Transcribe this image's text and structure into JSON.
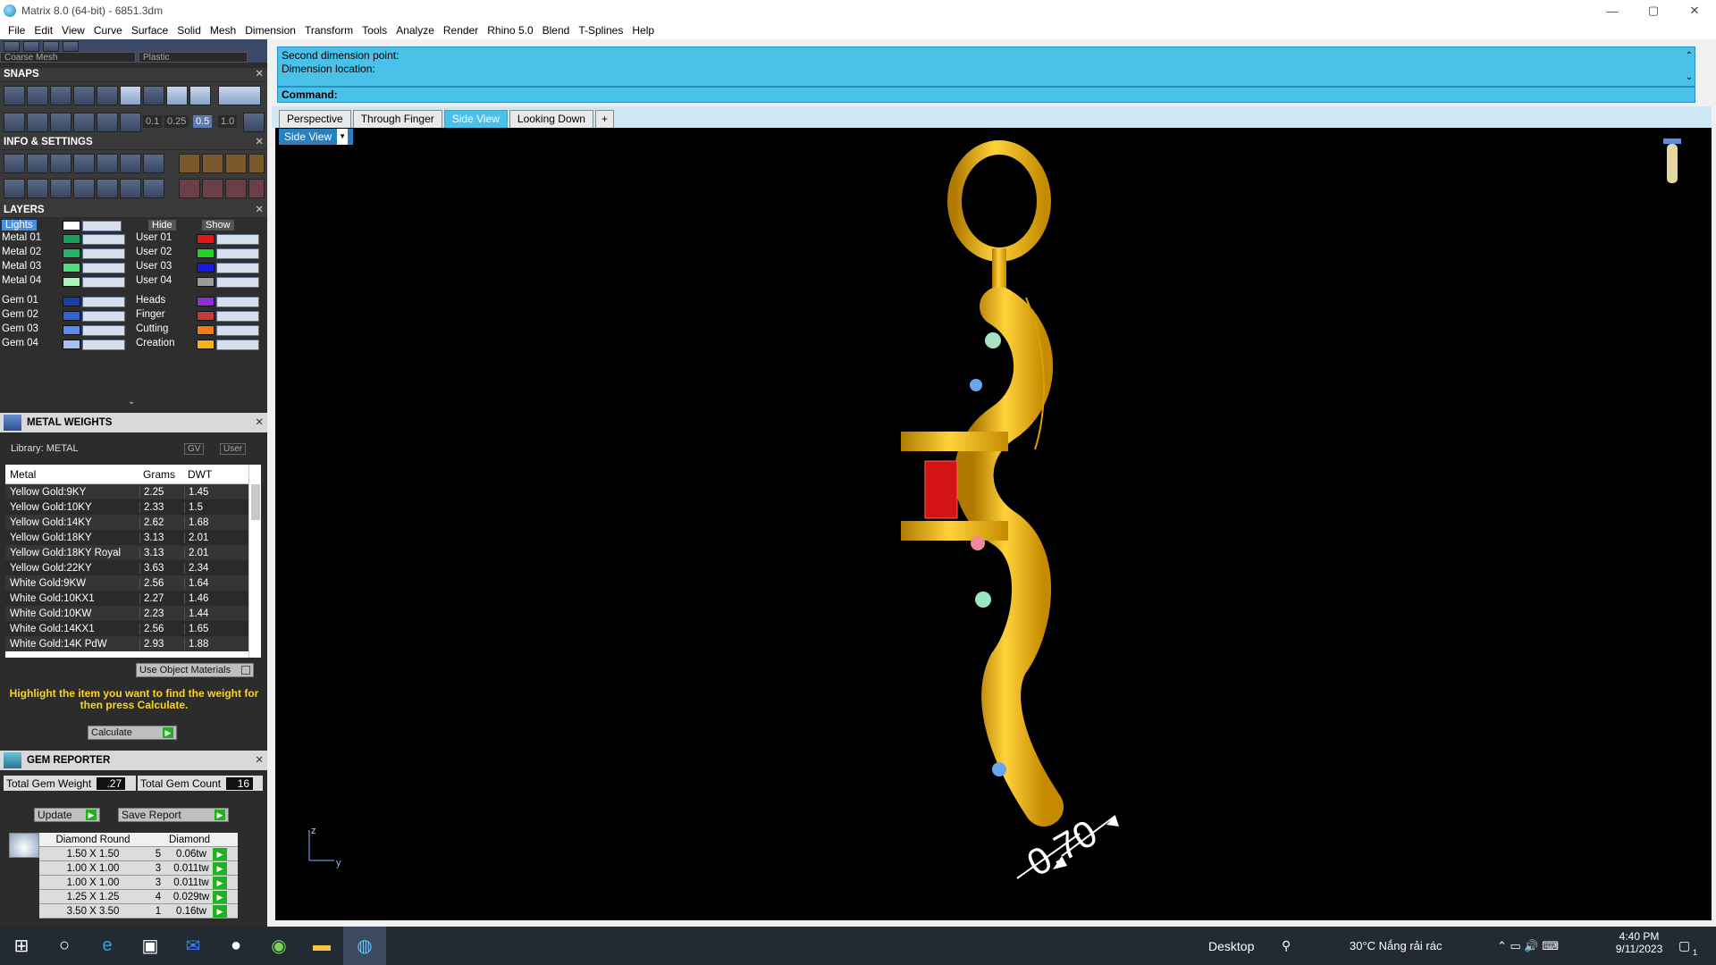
{
  "window": {
    "title": "Matrix 8.0 (64-bit) - 6851.3dm",
    "min": "—",
    "max": "▢",
    "close": "✕"
  },
  "menu": [
    "File",
    "Edit",
    "View",
    "Curve",
    "Surface",
    "Solid",
    "Mesh",
    "Dimension",
    "Transform",
    "Tools",
    "Analyze",
    "Render",
    "Rhino 5.0",
    "Blend",
    "T-Splines",
    "Help"
  ],
  "toolbar_top": {
    "mesh": "Coarse Mesh",
    "material": "Plastic"
  },
  "panels": {
    "snaps": "SNAPS",
    "snap_values": [
      "0.1",
      "0.25",
      "0.5",
      "1.0"
    ],
    "info": "INFO & SETTINGS",
    "layers": "LAYERS",
    "metal_weights": "METAL WEIGHTS",
    "gem_reporter": "GEM REPORTER"
  },
  "layers": {
    "lights": "Lights",
    "hide": "Hide",
    "show": "Show",
    "left": [
      {
        "name": "Metal 01",
        "color": "#1e9c5a"
      },
      {
        "name": "Metal 02",
        "color": "#22b568"
      },
      {
        "name": "Metal 03",
        "color": "#4fe07d"
      },
      {
        "name": "Metal 04",
        "color": "#a9f5b6"
      },
      {
        "name": "Gem 01",
        "color": "#1b3fa8"
      },
      {
        "name": "Gem 02",
        "color": "#2f63d6"
      },
      {
        "name": "Gem 03",
        "color": "#5a8df0"
      },
      {
        "name": "Gem 04",
        "color": "#a5c2f5"
      }
    ],
    "right": [
      {
        "name": "User 01",
        "color": "#e01818"
      },
      {
        "name": "User 02",
        "color": "#22d21e"
      },
      {
        "name": "User 03",
        "color": "#1a1ae6"
      },
      {
        "name": "User 04",
        "color": "#9a9a9a"
      },
      {
        "name": "Heads",
        "color": "#8a2fd6"
      },
      {
        "name": "Finger",
        "color": "#c23a3a"
      },
      {
        "name": "Cutting",
        "color": "#f07b1a"
      },
      {
        "name": "Creation",
        "color": "#f7b21a"
      }
    ]
  },
  "metal_weights": {
    "library": "Library: METAL",
    "gv": "GV",
    "user": "User",
    "headers": [
      "Metal",
      "Grams",
      "DWT"
    ],
    "rows": [
      [
        "Yellow Gold:9KY",
        "2.25",
        "1.45"
      ],
      [
        "Yellow Gold:10KY",
        "2.33",
        "1.5"
      ],
      [
        "Yellow Gold:14KY",
        "2.62",
        "1.68"
      ],
      [
        "Yellow Gold:18KY",
        "3.13",
        "2.01"
      ],
      [
        "Yellow Gold:18KY Royal",
        "3.13",
        "2.01"
      ],
      [
        "Yellow Gold:22KY",
        "3.63",
        "2.34"
      ],
      [
        "White Gold:9KW",
        "2.56",
        "1.64"
      ],
      [
        "White Gold:10KX1",
        "2.27",
        "1.46"
      ],
      [
        "White Gold:10KW",
        "2.23",
        "1.44"
      ],
      [
        "White Gold:14KX1",
        "2.56",
        "1.65"
      ],
      [
        "White Gold:14K PdW",
        "2.93",
        "1.88"
      ]
    ],
    "use_object": "Use Object Materials",
    "message": "Highlight the item you want to find the weight for then press Calculate.",
    "calculate": "Calculate"
  },
  "gem_reporter": {
    "total_weight_label": "Total Gem Weight",
    "total_weight": ".27",
    "total_count_label": "Total Gem Count",
    "total_count": "16",
    "update": "Update",
    "save_report": "Save Report",
    "headers": [
      "Diamond Round",
      "Diamond"
    ],
    "rows": [
      [
        "1.50 X 1.50",
        "5",
        "0.06tw"
      ],
      [
        "1.00 X 1.00",
        "3",
        "0.011tw"
      ],
      [
        "1.00 X 1.00",
        "3",
        "0.011tw"
      ],
      [
        "1.25 X 1.25",
        "4",
        "0.029tw"
      ],
      [
        "3.50 X 3.50",
        "1",
        "0.16tw"
      ]
    ]
  },
  "command": {
    "line1": "Second dimension point:",
    "line2": "Dimension location:",
    "prompt": "Command:"
  },
  "tabs": [
    "Perspective",
    "Through Finger",
    "Side View",
    "Looking Down",
    "+"
  ],
  "active_tab": "Side View",
  "viewport": {
    "label": "Side View",
    "dimension": "0.70",
    "axis_z": "z",
    "axis_y": "y"
  },
  "taskbar": {
    "desktop": "Desktop",
    "weather": "30°C  Nắng rải rác",
    "time": "4:40 PM",
    "date": "9/11/2023",
    "notif": "1"
  }
}
